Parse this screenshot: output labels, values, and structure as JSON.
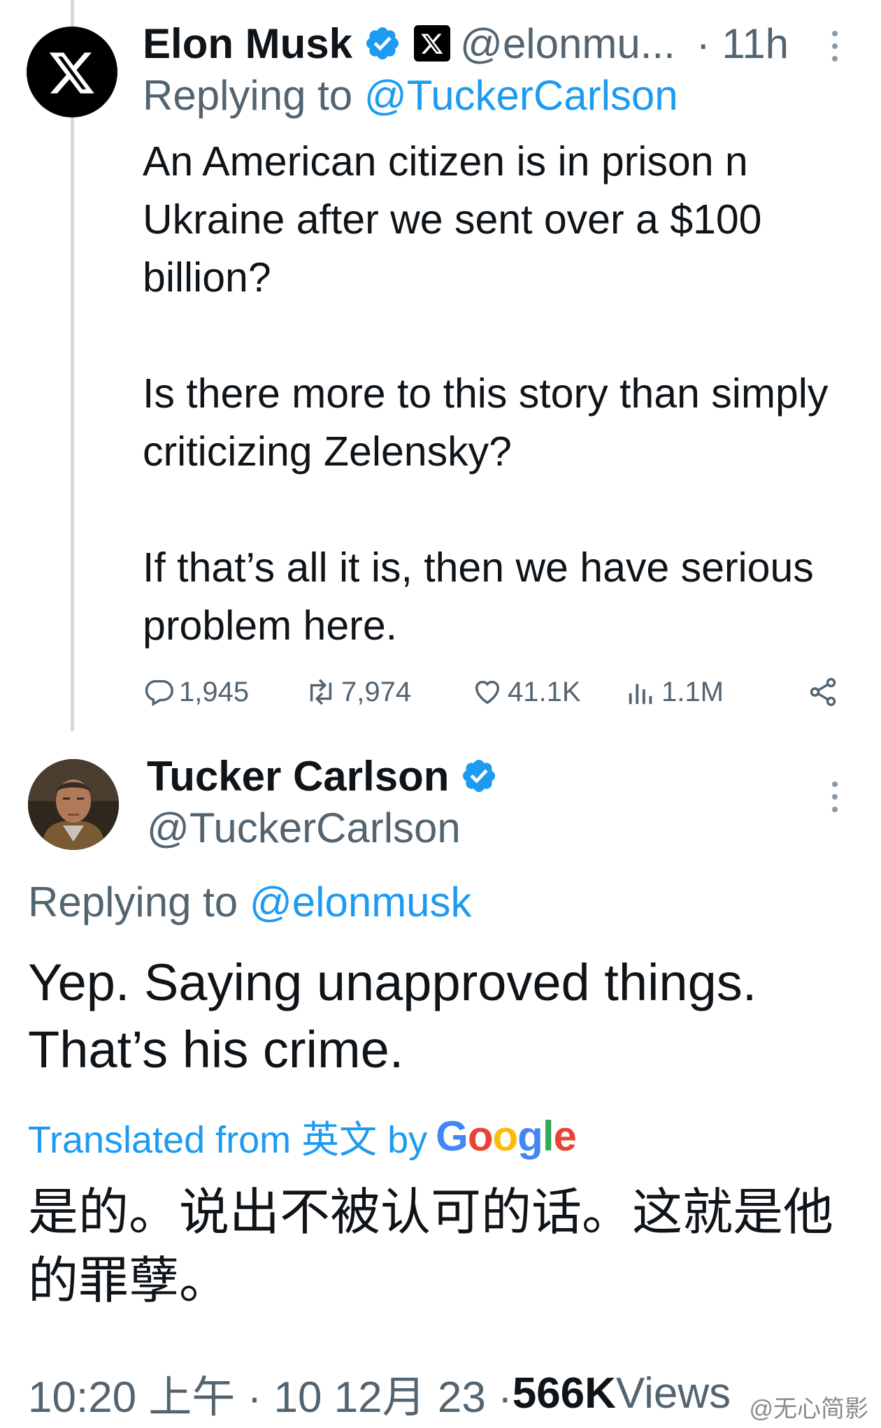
{
  "elon_tweet": {
    "name": "Elon Musk",
    "handle": "@elonmu...",
    "time": "· 11h",
    "replying_prefix": "Replying to ",
    "replying_to": "@TuckerCarlson",
    "paragraphs": [
      "An American citizen is in prison n Ukraine after we sent over a $100 billion?",
      "Is there more to this story than simply criticizing Zelensky?",
      "If that’s all it is, then we have serious problem here."
    ],
    "actions": {
      "replies": "1,945",
      "retweets": "7,974",
      "likes": "41.1K",
      "views": "1.1M"
    }
  },
  "tucker_tweet": {
    "name": "Tucker Carlson",
    "handle": "@TuckerCarlson",
    "replying_prefix": "Replying to ",
    "replying_to": "@elonmusk",
    "text": "Yep. Saying unapproved things. That’s his crime.",
    "translated_label": "Translated from 英文 by",
    "translation": "是的。说出不被认可的话。这就是他的罪孽。",
    "footer_time": "10:20 上午 · 10 12月 23 · ",
    "footer_views_count": "566K",
    "footer_views_label": " Views"
  },
  "watermark": "@无心简影",
  "colors": {
    "accent": "#1d9bf0",
    "muted": "#536471",
    "text": "#0f1419"
  }
}
